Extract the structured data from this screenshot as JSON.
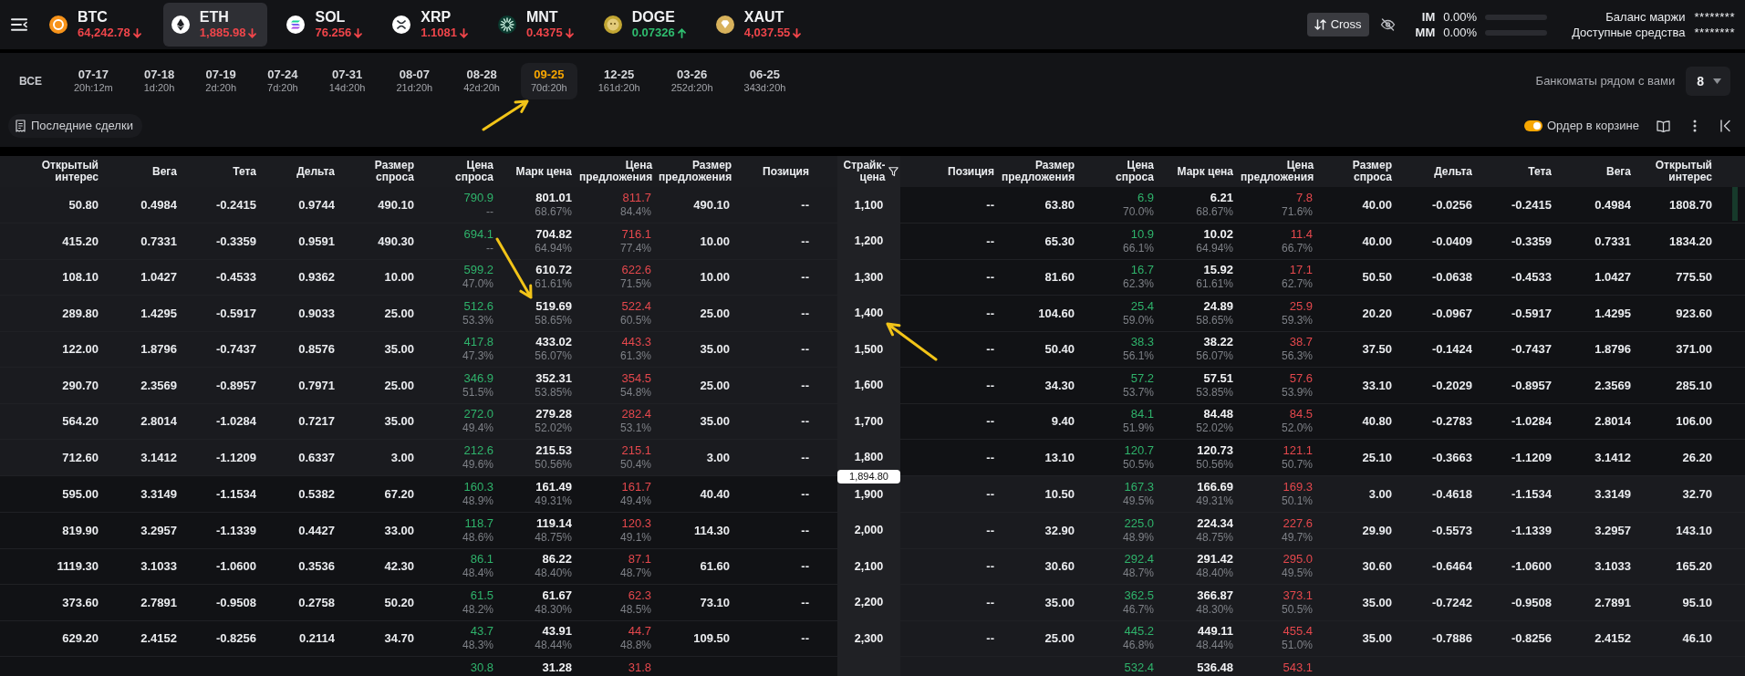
{
  "top_bar": {
    "coins": [
      {
        "symbol": "BTC",
        "price": "64,242.78",
        "rising": false,
        "selected": false
      },
      {
        "symbol": "ETH",
        "price": "1,885.98",
        "rising": false,
        "selected": true
      },
      {
        "symbol": "SOL",
        "price": "76.256",
        "rising": false,
        "selected": false
      },
      {
        "symbol": "XRP",
        "price": "1.1081",
        "rising": false,
        "selected": false
      },
      {
        "symbol": "MNT",
        "price": "0.4375",
        "rising": false,
        "selected": false
      },
      {
        "symbol": "DOGE",
        "price": "0.07326",
        "rising": true,
        "selected": false
      },
      {
        "symbol": "XAUT",
        "price": "4,037.55",
        "rising": false,
        "selected": false
      }
    ],
    "margin_mode": "Cross",
    "margin": [
      {
        "label": "IM",
        "value": "0.00%",
        "level": 0
      },
      {
        "label": "MM",
        "value": "0.00%",
        "level": 0
      }
    ],
    "balances": [
      {
        "label": "Баланс маржи",
        "value": "********"
      },
      {
        "label": "Доступные средства",
        "value": "********"
      }
    ]
  },
  "expiry_bar": {
    "all": {
      "label": "ВСЕ",
      "selected": false
    },
    "expiries": [
      {
        "date": "07-17",
        "countdown": "20h:12m",
        "selected": false
      },
      {
        "date": "07-18",
        "countdown": "1d:20h",
        "selected": false
      },
      {
        "date": "07-19",
        "countdown": "2d:20h",
        "selected": false
      },
      {
        "date": "07-24",
        "countdown": "7d:20h",
        "selected": false
      },
      {
        "date": "07-31",
        "countdown": "14d:20h",
        "selected": false
      },
      {
        "date": "08-07",
        "countdown": "21d:20h",
        "selected": false
      },
      {
        "date": "08-28",
        "countdown": "42d:20h",
        "selected": false
      },
      {
        "date": "09-25",
        "countdown": "70d:20h",
        "selected": true
      },
      {
        "date": "12-25",
        "countdown": "161d:20h",
        "selected": false
      },
      {
        "date": "03-26",
        "countdown": "252d:20h",
        "selected": false
      },
      {
        "date": "06-25",
        "countdown": "343d:20h",
        "selected": false
      }
    ],
    "select_label": "Банкоматы рядом с вами",
    "select_value": "8"
  },
  "toolbar": {
    "recent_trades": "Последние сделки",
    "basket_order": {
      "label": "Ордер в корзине",
      "on": true
    }
  },
  "chain": {
    "call_columns": [
      {
        "label": "Открытый\nинтерес",
        "kind": "plain"
      },
      {
        "label": "Вега",
        "kind": "plain"
      },
      {
        "label": "Тета",
        "kind": "plain"
      },
      {
        "label": "Дельта",
        "kind": "plain"
      },
      {
        "label": "Размер\nспроса",
        "kind": "plain"
      },
      {
        "label": "Цена\nспроса",
        "kind": "bid"
      },
      {
        "label": "Марк цена",
        "kind": "mark"
      },
      {
        "label": "Цена\nпредложения",
        "kind": "ask"
      },
      {
        "label": "Размер\nпредложения",
        "kind": "plain"
      },
      {
        "label": "Позиция",
        "kind": "plain"
      }
    ],
    "strike_column": "Страйк-цена",
    "put_columns": [
      {
        "label": "Позиция",
        "kind": "plain"
      },
      {
        "label": "Размер\nпредложения",
        "kind": "plain"
      },
      {
        "label": "Цена\nспроса",
        "kind": "bid"
      },
      {
        "label": "Марк цена",
        "kind": "mark"
      },
      {
        "label": "Цена\nпредложения",
        "kind": "ask"
      },
      {
        "label": "Размер\nспроса",
        "kind": "plain"
      },
      {
        "label": "Дельта",
        "kind": "plain"
      },
      {
        "label": "Тета",
        "kind": "plain"
      },
      {
        "label": "Вега",
        "kind": "plain"
      },
      {
        "label": "Открытый\nинтерес",
        "kind": "plain"
      }
    ],
    "rows": [
      {
        "kind": "strike",
        "strike": "1,100",
        "call": [
          "50.80",
          "0.4984",
          "-0.2415",
          "0.9744",
          "490.10",
          [
            "790.9",
            "--"
          ],
          [
            "801.01",
            "68.67%"
          ],
          [
            "811.7",
            "84.4%"
          ],
          "490.10",
          "--"
        ],
        "put": [
          "--",
          "63.80",
          [
            "6.9",
            "70.0%"
          ],
          [
            "6.21",
            "68.67%"
          ],
          [
            "7.8",
            "71.6%"
          ],
          "40.00",
          "-0.0256",
          "-0.2415",
          "0.4984",
          "1808.70"
        ]
      },
      {
        "kind": "strike",
        "strike": "1,200",
        "call": [
          "415.20",
          "0.7331",
          "-0.3359",
          "0.9591",
          "490.30",
          [
            "694.1",
            "--"
          ],
          [
            "704.82",
            "64.94%"
          ],
          [
            "716.1",
            "77.4%"
          ],
          "10.00",
          "--"
        ],
        "put": [
          "--",
          "65.30",
          [
            "10.9",
            "66.1%"
          ],
          [
            "10.02",
            "64.94%"
          ],
          [
            "11.4",
            "66.7%"
          ],
          "40.00",
          "-0.0409",
          "-0.3359",
          "0.7331",
          "1834.20"
        ]
      },
      {
        "kind": "strike",
        "strike": "1,300",
        "call": [
          "108.10",
          "1.0427",
          "-0.4533",
          "0.9362",
          "10.00",
          [
            "599.2",
            "47.0%"
          ],
          [
            "610.72",
            "61.61%"
          ],
          [
            "622.6",
            "71.5%"
          ],
          "10.00",
          "--"
        ],
        "put": [
          "--",
          "81.60",
          [
            "16.7",
            "62.3%"
          ],
          [
            "15.92",
            "61.61%"
          ],
          [
            "17.1",
            "62.7%"
          ],
          "50.50",
          "-0.0638",
          "-0.4533",
          "1.0427",
          "775.50"
        ]
      },
      {
        "kind": "strike",
        "strike": "1,400",
        "call": [
          "289.80",
          "1.4295",
          "-0.5917",
          "0.9033",
          "25.00",
          [
            "512.6",
            "53.3%"
          ],
          [
            "519.69",
            "58.65%"
          ],
          [
            "522.4",
            "60.5%"
          ],
          "25.00",
          "--"
        ],
        "put": [
          "--",
          "104.60",
          [
            "25.4",
            "59.0%"
          ],
          [
            "24.89",
            "58.65%"
          ],
          [
            "25.9",
            "59.3%"
          ],
          "20.20",
          "-0.0967",
          "-0.5917",
          "1.4295",
          "923.60"
        ]
      },
      {
        "kind": "strike",
        "strike": "1,500",
        "call": [
          "122.00",
          "1.8796",
          "-0.7437",
          "0.8576",
          "35.00",
          [
            "417.8",
            "47.3%"
          ],
          [
            "433.02",
            "56.07%"
          ],
          [
            "443.3",
            "61.3%"
          ],
          "35.00",
          "--"
        ],
        "put": [
          "--",
          "50.40",
          [
            "38.3",
            "56.1%"
          ],
          [
            "38.22",
            "56.07%"
          ],
          [
            "38.7",
            "56.3%"
          ],
          "37.50",
          "-0.1424",
          "-0.7437",
          "1.8796",
          "371.00"
        ]
      },
      {
        "kind": "strike",
        "strike": "1,600",
        "call": [
          "290.70",
          "2.3569",
          "-0.8957",
          "0.7971",
          "25.00",
          [
            "346.9",
            "51.5%"
          ],
          [
            "352.31",
            "53.85%"
          ],
          [
            "354.5",
            "54.8%"
          ],
          "25.00",
          "--"
        ],
        "put": [
          "--",
          "34.30",
          [
            "57.2",
            "53.7%"
          ],
          [
            "57.51",
            "53.85%"
          ],
          [
            "57.6",
            "53.9%"
          ],
          "33.10",
          "-0.2029",
          "-0.8957",
          "2.3569",
          "285.10"
        ]
      },
      {
        "kind": "strike",
        "strike": "1,700",
        "call": [
          "564.20",
          "2.8014",
          "-1.0284",
          "0.7217",
          "35.00",
          [
            "272.0",
            "49.4%"
          ],
          [
            "279.28",
            "52.02%"
          ],
          [
            "282.4",
            "53.1%"
          ],
          "35.00",
          "--"
        ],
        "put": [
          "--",
          "9.40",
          [
            "84.1",
            "51.9%"
          ],
          [
            "84.48",
            "52.02%"
          ],
          [
            "84.5",
            "52.0%"
          ],
          "40.80",
          "-0.2783",
          "-1.0284",
          "2.8014",
          "106.00"
        ]
      },
      {
        "kind": "strike",
        "strike": "1,800",
        "call": [
          "712.60",
          "3.1412",
          "-1.1209",
          "0.6337",
          "3.00",
          [
            "212.6",
            "49.6%"
          ],
          [
            "215.53",
            "50.56%"
          ],
          [
            "215.1",
            "50.4%"
          ],
          "3.00",
          "--"
        ],
        "put": [
          "--",
          "13.10",
          [
            "120.7",
            "50.5%"
          ],
          [
            "120.73",
            "50.56%"
          ],
          [
            "121.1",
            "50.7%"
          ],
          "25.10",
          "-0.3663",
          "-1.1209",
          "3.1412",
          "26.20"
        ]
      },
      {
        "kind": "price_line",
        "label": "1,894.80"
      },
      {
        "kind": "strike",
        "strike": "1,900",
        "call": [
          "595.00",
          "3.3149",
          "-1.1534",
          "0.5382",
          "67.20",
          [
            "160.3",
            "48.9%"
          ],
          [
            "161.49",
            "49.31%"
          ],
          [
            "161.7",
            "49.4%"
          ],
          "40.40",
          "--"
        ],
        "put": [
          "--",
          "10.50",
          [
            "167.3",
            "49.5%"
          ],
          [
            "166.69",
            "49.31%"
          ],
          [
            "169.3",
            "50.1%"
          ],
          "3.00",
          "-0.4618",
          "-1.1534",
          "3.3149",
          "32.70"
        ]
      },
      {
        "kind": "strike",
        "strike": "2,000",
        "call": [
          "819.90",
          "3.2957",
          "-1.1339",
          "0.4427",
          "33.00",
          [
            "118.7",
            "48.6%"
          ],
          [
            "119.14",
            "48.75%"
          ],
          [
            "120.3",
            "49.1%"
          ],
          "114.30",
          "--"
        ],
        "put": [
          "--",
          "32.90",
          [
            "225.0",
            "48.9%"
          ],
          [
            "224.34",
            "48.75%"
          ],
          [
            "227.6",
            "49.7%"
          ],
          "29.90",
          "-0.5573",
          "-1.1339",
          "3.2957",
          "143.10"
        ]
      },
      {
        "kind": "strike",
        "strike": "2,100",
        "call": [
          "1119.30",
          "3.1033",
          "-1.0600",
          "0.3536",
          "42.30",
          [
            "86.1",
            "48.4%"
          ],
          [
            "86.22",
            "48.40%"
          ],
          [
            "87.1",
            "48.7%"
          ],
          "61.60",
          "--"
        ],
        "put": [
          "--",
          "30.60",
          [
            "292.4",
            "48.7%"
          ],
          [
            "291.42",
            "48.40%"
          ],
          [
            "295.0",
            "49.5%"
          ],
          "30.60",
          "-0.6464",
          "-1.0600",
          "3.1033",
          "165.20"
        ]
      },
      {
        "kind": "strike",
        "strike": "2,200",
        "call": [
          "373.60",
          "2.7891",
          "-0.9508",
          "0.2758",
          "50.20",
          [
            "61.5",
            "48.2%"
          ],
          [
            "61.67",
            "48.30%"
          ],
          [
            "62.3",
            "48.5%"
          ],
          "73.10",
          "--"
        ],
        "put": [
          "--",
          "35.00",
          [
            "362.5",
            "46.7%"
          ],
          [
            "366.87",
            "48.30%"
          ],
          [
            "373.1",
            "50.5%"
          ],
          "35.00",
          "-0.7242",
          "-0.9508",
          "2.7891",
          "95.10"
        ]
      },
      {
        "kind": "strike",
        "strike": "2,300",
        "call": [
          "629.20",
          "2.4152",
          "-0.8256",
          "0.2114",
          "34.70",
          [
            "43.7",
            "48.3%"
          ],
          [
            "43.91",
            "48.44%"
          ],
          [
            "44.7",
            "48.8%"
          ],
          "109.50",
          "--"
        ],
        "put": [
          "--",
          "25.00",
          [
            "445.2",
            "46.8%"
          ],
          [
            "449.11",
            "48.44%"
          ],
          [
            "455.4",
            "51.0%"
          ],
          "35.00",
          "-0.7886",
          "-0.8256",
          "2.4152",
          "46.10"
        ]
      },
      {
        "kind": "partial",
        "call": {
          "bid": "30.8",
          "mark": "31.28",
          "ask": "31.8"
        },
        "put": {
          "bid": "532.4",
          "mark": "536.48",
          "ask": "543.1"
        }
      }
    ]
  },
  "annotations": [
    {
      "kind": "arrow"
    },
    {
      "kind": "arrow"
    },
    {
      "kind": "arrow"
    }
  ]
}
